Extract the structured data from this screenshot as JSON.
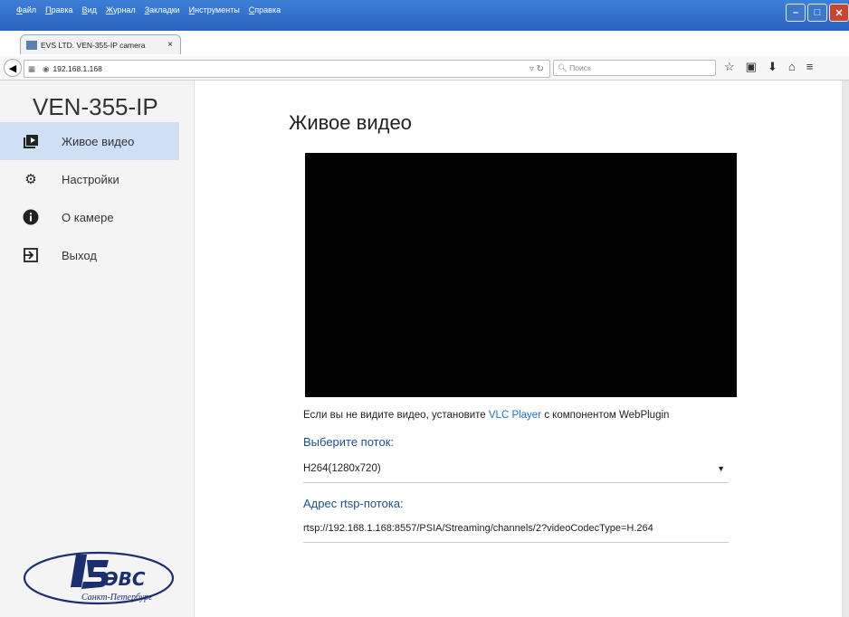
{
  "menu": [
    "Файл",
    "Правка",
    "Вид",
    "Журнал",
    "Закладки",
    "Инструменты",
    "Справка"
  ],
  "tab": {
    "title": "EVS LTD. VEN-355-IP camera",
    "close": "×",
    "new": "+"
  },
  "address": {
    "url": "192.168.1.168",
    "search_placeholder": "Поиск"
  },
  "sidebar": {
    "brand": "VEN-355-IP",
    "items": [
      {
        "label": "Живое видео",
        "icon": "play-box-icon"
      },
      {
        "label": "Настройки",
        "icon": "gear-icon"
      },
      {
        "label": "О камере",
        "icon": "info-icon"
      },
      {
        "label": "Выход",
        "icon": "exit-icon"
      }
    ],
    "logo_text": "ЭВС",
    "logo_sub": "Санкт-Петербург"
  },
  "main": {
    "title": "Живое видео",
    "hint_before": "Если вы не видите видео, установите ",
    "hint_link": "VLC Player",
    "hint_after": " с компонентом WebPlugin",
    "stream_label": "Выберите поток:",
    "stream_value": "H264(1280x720)",
    "rtsp_label": "Адрес rtsp-потока:",
    "rtsp_value": "rtsp://192.168.1.168:8557/PSIA/Streaming/channels/2?videoCodecType=H.264"
  },
  "colors": {
    "accent": "#1e6fc9",
    "active_bg": "#cfe0f5"
  }
}
